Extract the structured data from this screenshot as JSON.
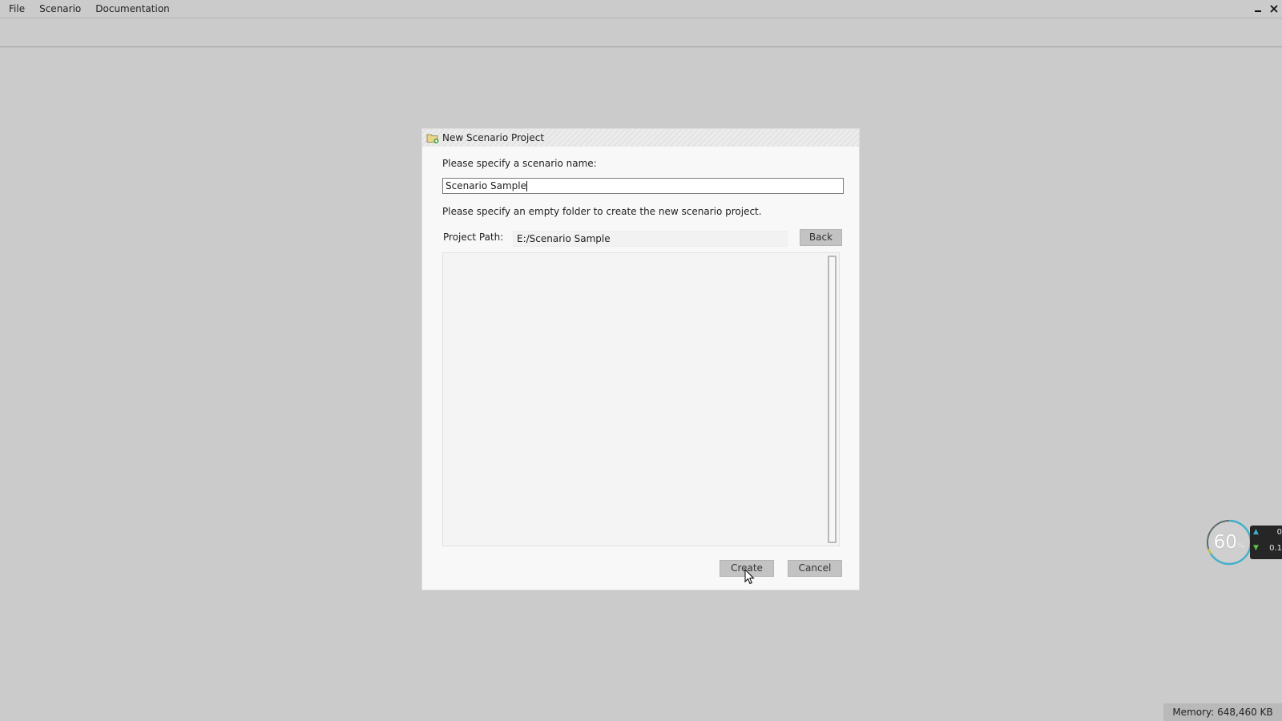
{
  "menu": {
    "file": "File",
    "scenario": "Scenario",
    "documentation": "Documentation"
  },
  "window_controls": {
    "minimize_icon": "minimize-icon",
    "close_icon": "close-icon"
  },
  "dialog": {
    "title": "New Scenario Project",
    "title_icon": "new-folder-icon",
    "name_prompt": "Please specify a scenario name:",
    "name_value": "Scenario Sample",
    "folder_prompt": "Please specify an empty folder to create the new scenario project.",
    "project_path_label": "Project Path:",
    "project_path_value": "E:/Scenario Sample",
    "back_button": "Back",
    "create_button": "Create",
    "cancel_button": "Cancel"
  },
  "perf_widget": {
    "value": "60",
    "unit": "%",
    "upload": "0",
    "download": "0.1",
    "accent_color": "#3fb0c9"
  },
  "status": {
    "memory": "Memory: 648,460 KB"
  }
}
